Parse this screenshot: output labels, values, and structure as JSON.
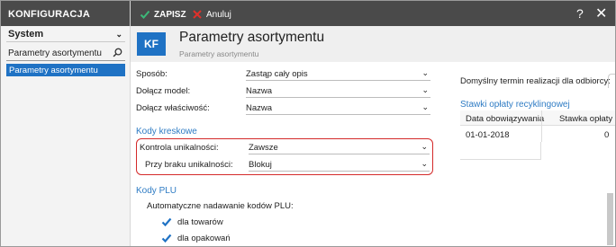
{
  "sidebar": {
    "header": "KONFIGURACJA",
    "dropdown_value": "System",
    "search_value": "Parametry asortymentu",
    "selected_item": "Parametry asortymentu"
  },
  "toolbar": {
    "save_label": "ZAPISZ",
    "cancel_label": "Anuluj",
    "help": "?",
    "close": "✕"
  },
  "header": {
    "badge": "KF",
    "title": "Parametry asortymentu",
    "subtitle": "Parametry asortymentu"
  },
  "form": {
    "sposob": {
      "label": "Sposób:",
      "value": "Zastąp cały opis"
    },
    "dolacz_model": {
      "label": "Dołącz model:",
      "value": "Nazwa"
    },
    "dolacz_wlasciwosc": {
      "label": "Dołącz właściwość:",
      "value": "Nazwa"
    },
    "barcodes_section": "Kody kreskowe",
    "kontrola": {
      "label": "Kontrola unikalności:",
      "value": "Zawsze"
    },
    "przy_braku": {
      "label": "Przy braku unikalności:",
      "value": "Blokuj"
    },
    "plu_section": "Kody PLU",
    "auto_label": "Automatyczne nadawanie kodów PLU:",
    "check_towary": "dla towarów",
    "check_opakowania": "dla opakowań"
  },
  "right_panel": {
    "default_term_label": "Domyślny termin realizacji dla odbiorcy:",
    "recycling_section": "Stawki opłaty recyklingowej",
    "table": {
      "headers": [
        "Data obowiązywania",
        "Stawka opłaty"
      ],
      "rows": [
        [
          "01-01-2018",
          "0"
        ]
      ]
    }
  },
  "colors": {
    "accent": "#1f72c4",
    "toolbar_bg": "#4a4a4a",
    "save_check": "#3cb878",
    "cancel_x": "#e0302a",
    "highlight_border": "#d42a2a"
  }
}
